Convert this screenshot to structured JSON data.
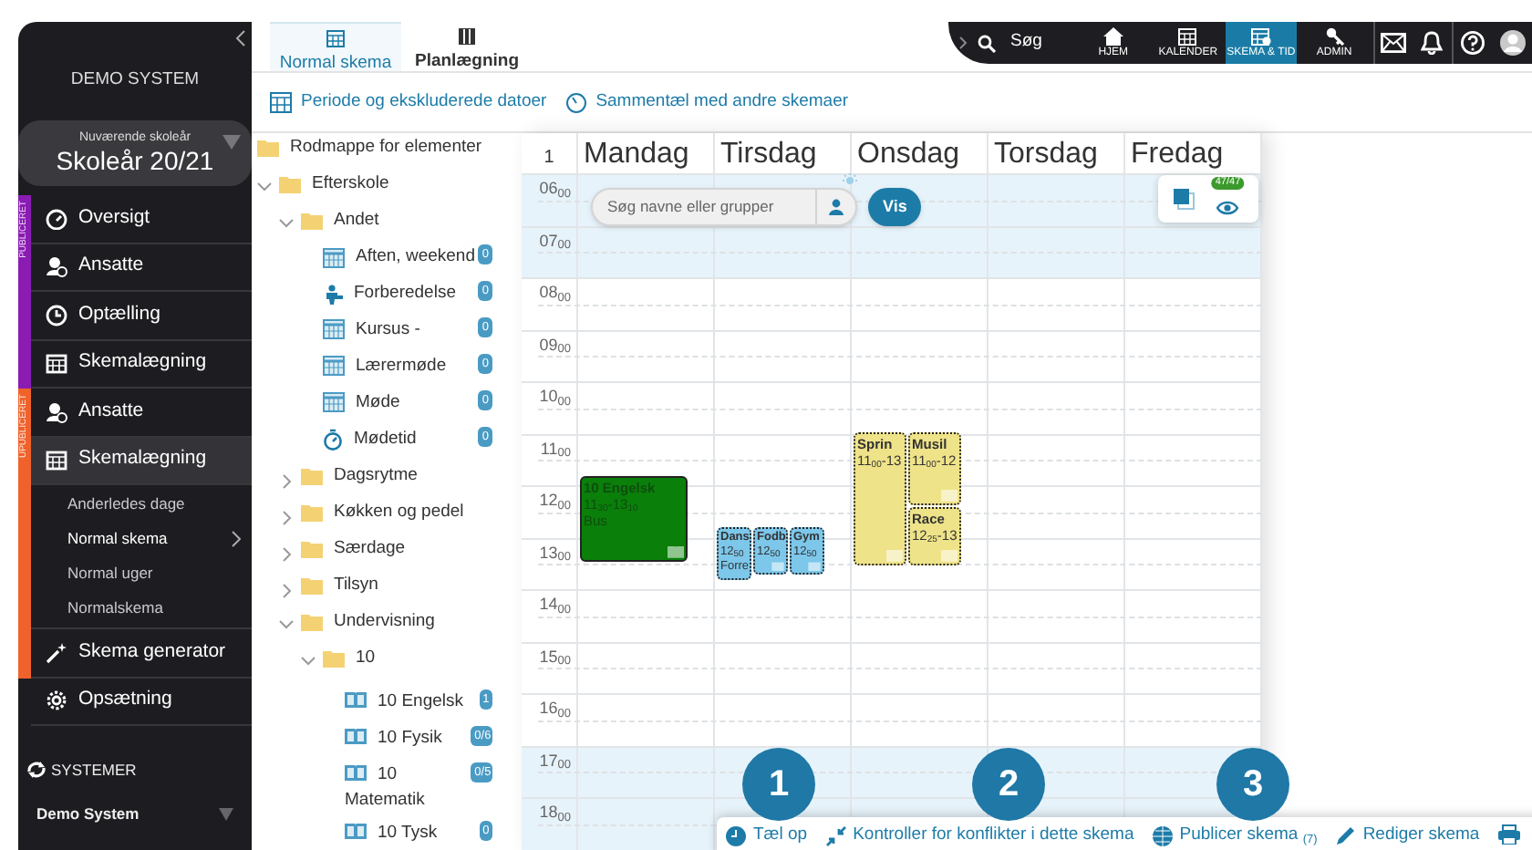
{
  "sidebar": {
    "title": "DEMO SYSTEM",
    "year": {
      "label": "Nuværende skoleår",
      "value": "Skoleår 20/21"
    },
    "sections": [
      {
        "label": "PUBLICERET",
        "color": "#8a1bb3",
        "items": [
          {
            "kind": "gauge",
            "label": "Oversigt",
            "selected": false
          },
          {
            "kind": "staff",
            "label": "Ansatte",
            "selected": false
          },
          {
            "kind": "clock",
            "label": "Optælling",
            "selected": false
          },
          {
            "kind": "calendar",
            "label": "Skemalægning",
            "selected": false
          }
        ]
      },
      {
        "label": "UPUBLICERET",
        "color": "#f0622b",
        "items": [
          {
            "kind": "staff",
            "label": "Ansatte",
            "selected": false
          },
          {
            "kind": "calendar",
            "label": "Skemalægning",
            "selected": true,
            "children": [
              {
                "label": "Anderledes dage",
                "selected": false
              },
              {
                "label": "Normal skema",
                "selected": true
              },
              {
                "label": "Normal uger",
                "selected": false
              },
              {
                "label": "Normalskema",
                "selected": false
              }
            ]
          },
          {
            "kind": "wand",
            "label": "Skema generator",
            "selected": false
          }
        ]
      },
      {
        "items": [
          {
            "kind": "gear",
            "label": "Opsætning",
            "selected": false
          }
        ]
      }
    ],
    "systems": {
      "heading": "SYSTEMER",
      "value": "Demo System"
    }
  },
  "topbar": {
    "search_label": "Søg",
    "nav": [
      {
        "kind": "home",
        "label": "HJEM",
        "selected": false
      },
      {
        "kind": "calendar",
        "label": "KALENDER",
        "selected": false
      },
      {
        "kind": "schedule",
        "label": "SKEMA & TID",
        "selected": true
      },
      {
        "kind": "key",
        "label": "ADMIN",
        "selected": false
      }
    ],
    "icons": [
      {
        "kind": "mail"
      },
      {
        "kind": "bell"
      },
      {
        "kind": "help"
      },
      {
        "kind": "avatar"
      }
    ]
  },
  "tabs": [
    {
      "kind": "calendar",
      "label": "Normal skema",
      "selected": true
    },
    {
      "kind": "columns",
      "label": "Planlægning",
      "selected": false
    }
  ],
  "toolbar": [
    {
      "kind": "calendar",
      "label": "Periode og ekskluderede datoer"
    },
    {
      "kind": "timer",
      "label": "Sammentæl med andre skemaer"
    }
  ],
  "tree": [
    {
      "kind": "folder",
      "label": "Rodmappe for elementer",
      "children": [
        {
          "kind": "folder",
          "label": "Efterskole",
          "expanded": true,
          "children": [
            {
              "kind": "folder",
              "label": "Andet",
              "expanded": true,
              "children": [
                {
                  "kind": "calendar",
                  "label": "Aften, weekend",
                  "badge": "0"
                },
                {
                  "kind": "person",
                  "label": "Forberedelse",
                  "badge": "0"
                },
                {
                  "kind": "calendar",
                  "label": "Kursus -",
                  "badge": "0"
                },
                {
                  "kind": "calendar",
                  "label": "Lærermøde",
                  "badge": "0"
                },
                {
                  "kind": "calendar",
                  "label": "Møde",
                  "badge": "0"
                },
                {
                  "kind": "timer",
                  "label": "Mødetid",
                  "badge": "0"
                }
              ]
            },
            {
              "kind": "folder",
              "label": "Dagsrytme",
              "expanded": false
            },
            {
              "kind": "folder",
              "label": "Køkken og pedel",
              "expanded": false
            },
            {
              "kind": "folder",
              "label": "Særdage",
              "expanded": false
            },
            {
              "kind": "folder",
              "label": "Tilsyn",
              "expanded": false
            },
            {
              "kind": "folder",
              "label": "Undervisning",
              "expanded": true,
              "children": [
                {
                  "kind": "folder",
                  "label": "10",
                  "expanded": true,
                  "children": [
                    {
                      "kind": "book",
                      "label": "10 Engelsk",
                      "badge": "1"
                    },
                    {
                      "kind": "book",
                      "label": "10 Fysik",
                      "badge": "0/6"
                    },
                    {
                      "kind": "book",
                      "label": "10 Matematik",
                      "badge": "0/5"
                    },
                    {
                      "kind": "book",
                      "label": "10 Tysk",
                      "badge": "0"
                    }
                  ]
                }
              ]
            }
          ]
        }
      ]
    }
  ],
  "calendar": {
    "week": "1",
    "days": [
      {
        "name": "Mandag",
        "lanes": [
          [
            {
              "title": "10 Engelsk",
              "time": "11$_{30}$-13$_{10}$",
              "note": "Bus",
              "color": "#0a7f0a"
            }
          ]
        ]
      },
      {
        "name": "Tirsdag",
        "lanes": [
          [
            {
              "title": "Dans",
              "time": "12$_{50}$",
              "note": "Forre",
              "color": "#7cc7ea"
            }
          ],
          [
            {
              "title": "Fodb",
              "time": "12$_{50}$",
              "color": "#7cc7ea"
            }
          ],
          [
            {
              "title": "Gym",
              "time": "12$_{50}$",
              "color": "#7cc7ea"
            }
          ]
        ]
      },
      {
        "name": "Onsdag",
        "lanes": [
          [
            {
              "title": "Sprin",
              "time": "11$_{00}$-13",
              "color": "#efe389"
            }
          ],
          [
            {
              "title": "Musil",
              "time": "11$_{00}$-12",
              "color": "#efe389"
            },
            {
              "title": "Race",
              "time": "12$_{25}$-13",
              "color": "#efe389"
            }
          ]
        ]
      },
      {
        "name": "Torsdag"
      },
      {
        "name": "Fredag"
      }
    ],
    "hours": [
      {
        "label": "06$_{00}$",
        "off_hours": true
      },
      {
        "label": "07$_{00}$",
        "off_hours": true
      },
      {
        "label": "08$_{00}$",
        "off_hours": false
      },
      {
        "label": "09$_{00}$",
        "off_hours": false
      },
      {
        "label": "10$_{00}$",
        "off_hours": false
      },
      {
        "label": "11$_{00}$",
        "off_hours": false
      },
      {
        "label": "12$_{00}$",
        "off_hours": false
      },
      {
        "label": "13$_{00}$",
        "off_hours": false
      },
      {
        "label": "14$_{00}$",
        "off_hours": false
      },
      {
        "label": "15$_{00}$",
        "off_hours": false
      },
      {
        "label": "16$_{00}$",
        "off_hours": false
      },
      {
        "label": "17$_{00}$",
        "off_hours": true
      },
      {
        "label": "18$_{00}$",
        "off_hours": true
      }
    ],
    "search": {
      "placeholder": "Søg navne eller grupper",
      "button": "Vis"
    },
    "visible_count": "47/47"
  },
  "actions": [
    {
      "kind": "clock",
      "label": "Tæl op"
    },
    {
      "kind": "arrows",
      "label": "Kontroller for konflikter i dette skema"
    },
    {
      "kind": "globe",
      "label": "Publicer skema $_{(7)}$"
    },
    {
      "kind": "pencil",
      "label": "Rediger skema"
    },
    {
      "kind": "printer"
    }
  ],
  "callouts": [
    "1",
    "2",
    "3"
  ]
}
